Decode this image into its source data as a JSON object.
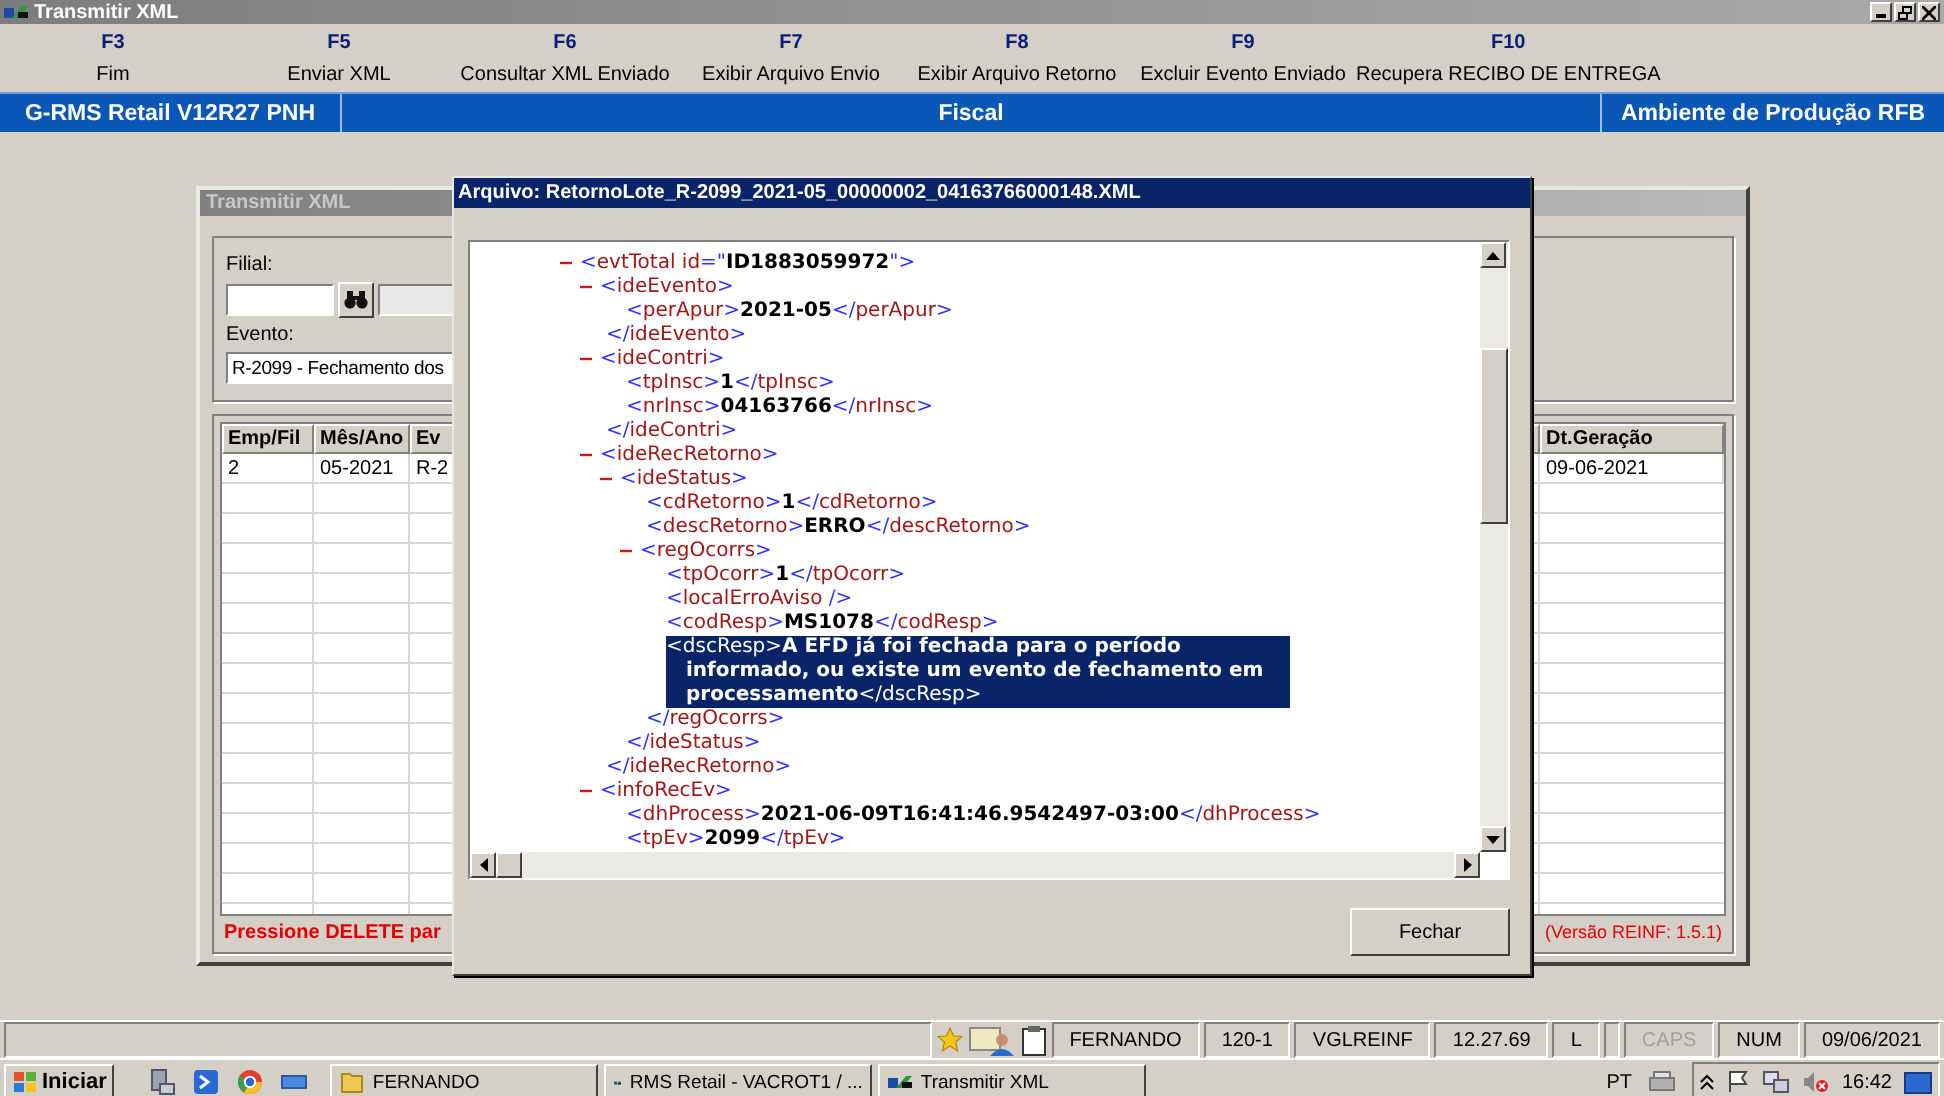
{
  "window": {
    "title": "Transmitir XML"
  },
  "function_keys": [
    {
      "key": "F3",
      "label": "Fim"
    },
    {
      "key": "F5",
      "label": "Enviar XML"
    },
    {
      "key": "F6",
      "label": "Consultar XML Enviado"
    },
    {
      "key": "F7",
      "label": "Exibir Arquivo Envio"
    },
    {
      "key": "F8",
      "label": "Exibir Arquivo Retorno"
    },
    {
      "key": "F9",
      "label": "Excluir Evento Enviado"
    },
    {
      "key": "F10",
      "label": "Recupera RECIBO DE ENTREGA"
    }
  ],
  "header_bar": {
    "system": "G-RMS Retail V12R27 PNH",
    "module": "Fiscal",
    "environment": "Ambiente de Produção RFB"
  },
  "background_window": {
    "title": "Transmitir XML",
    "filial_label": "Filial:",
    "evento_label": "Evento:",
    "evento_value": "R-2099 - Fechamento dos",
    "table": {
      "columns": [
        "Emp/Fil",
        "Mês/Ano",
        "Ev",
        "Dt.Geração"
      ],
      "rows": [
        [
          "2",
          "05-2021",
          "R-2",
          "09-06-2021"
        ]
      ]
    },
    "hint": "Pressione DELETE par",
    "version": "(Versão REINF: 1.5.1)"
  },
  "dialog": {
    "title": "Arquivo: RetornoLote_R-2099_2021-05_00000002_04163766000148.XML",
    "close_button": "Fechar",
    "xml": [
      {
        "open": "<evtTotal id=\"ID1883059972\">",
        "expanded": true,
        "selected": false,
        "children": [
          {
            "open": "<ideEvento>",
            "expanded": true,
            "selected": false,
            "close": "</ideEvento>",
            "children": [
              {
                "open": "<perApur>",
                "value": "2021-05",
                "close": "</perApur>",
                "selected": false
              }
            ]
          },
          {
            "open": "<ideContri>",
            "expanded": true,
            "selected": false,
            "close": "</ideContri>",
            "children": [
              {
                "open": "<tpInsc>",
                "value": "1",
                "close": "</tpInsc>",
                "selected": false
              },
              {
                "open": "<nrInsc>",
                "value": "04163766",
                "close": "</nrInsc>",
                "selected": false
              }
            ]
          },
          {
            "open": "<ideRecRetorno>",
            "expanded": true,
            "selected": false,
            "close": "</ideRecRetorno>",
            "children": [
              {
                "open": "<ideStatus>",
                "expanded": true,
                "selected": false,
                "close": "</ideStatus>",
                "children": [
                  {
                    "open": "<cdRetorno>",
                    "value": "1",
                    "close": "</cdRetorno>",
                    "selected": false
                  },
                  {
                    "open": "<descRetorno>",
                    "value": "ERRO",
                    "close": "</descRetorno>",
                    "selected": false
                  },
                  {
                    "open": "<regOcorrs>",
                    "expanded": true,
                    "selected": false,
                    "close": "</regOcorrs>",
                    "children": [
                      {
                        "open": "<tpOcorr>",
                        "value": "1",
                        "close": "</tpOcorr>",
                        "selected": false
                      },
                      {
                        "open": "<localErroAviso />",
                        "selected": false
                      },
                      {
                        "open": "<codResp>",
                        "value": "MS1078",
                        "close": "</codResp>",
                        "selected": false
                      },
                      {
                        "open": "<dscResp>",
                        "value": "A EFD já foi fechada para o período informado, ou existe um evento de fechamento em processamento",
                        "close": "</dscResp>",
                        "selected": true
                      }
                    ]
                  }
                ]
              }
            ]
          },
          {
            "open": "<infoRecEv>",
            "expanded": true,
            "selected": false,
            "children": [
              {
                "open": "<dhProcess>",
                "value": "2021-06-09T16:41:46.9542497-03:00",
                "close": "</dhProcess>",
                "selected": false
              },
              {
                "open": "<tpEv>",
                "value": "2099",
                "close": "</tpEv>",
                "selected": false
              }
            ]
          }
        ]
      }
    ]
  },
  "status_bar": {
    "cells": [
      {
        "kind": "text",
        "text": "FERNANDO"
      },
      {
        "kind": "text",
        "text": "120-1"
      },
      {
        "kind": "text",
        "text": "VGLREINF"
      },
      {
        "kind": "text",
        "text": "12.27.69"
      },
      {
        "kind": "text",
        "text": "L"
      },
      {
        "kind": "blank"
      },
      {
        "kind": "indicator",
        "text": "CAPS",
        "on": false
      },
      {
        "kind": "indicator",
        "text": "NUM",
        "on": true
      },
      {
        "kind": "text",
        "text": "09/06/2021"
      }
    ]
  },
  "taskbar": {
    "start": "Iniciar",
    "tasks": [
      {
        "kind": "folder",
        "label": "FERNANDO",
        "selected": false
      },
      {
        "kind": "app",
        "label": "RMS Retail - VACROT1 / ...",
        "selected": false
      },
      {
        "kind": "app",
        "label": "Transmitir XML",
        "selected": false
      }
    ],
    "language": "PT",
    "clock": "16:42"
  }
}
